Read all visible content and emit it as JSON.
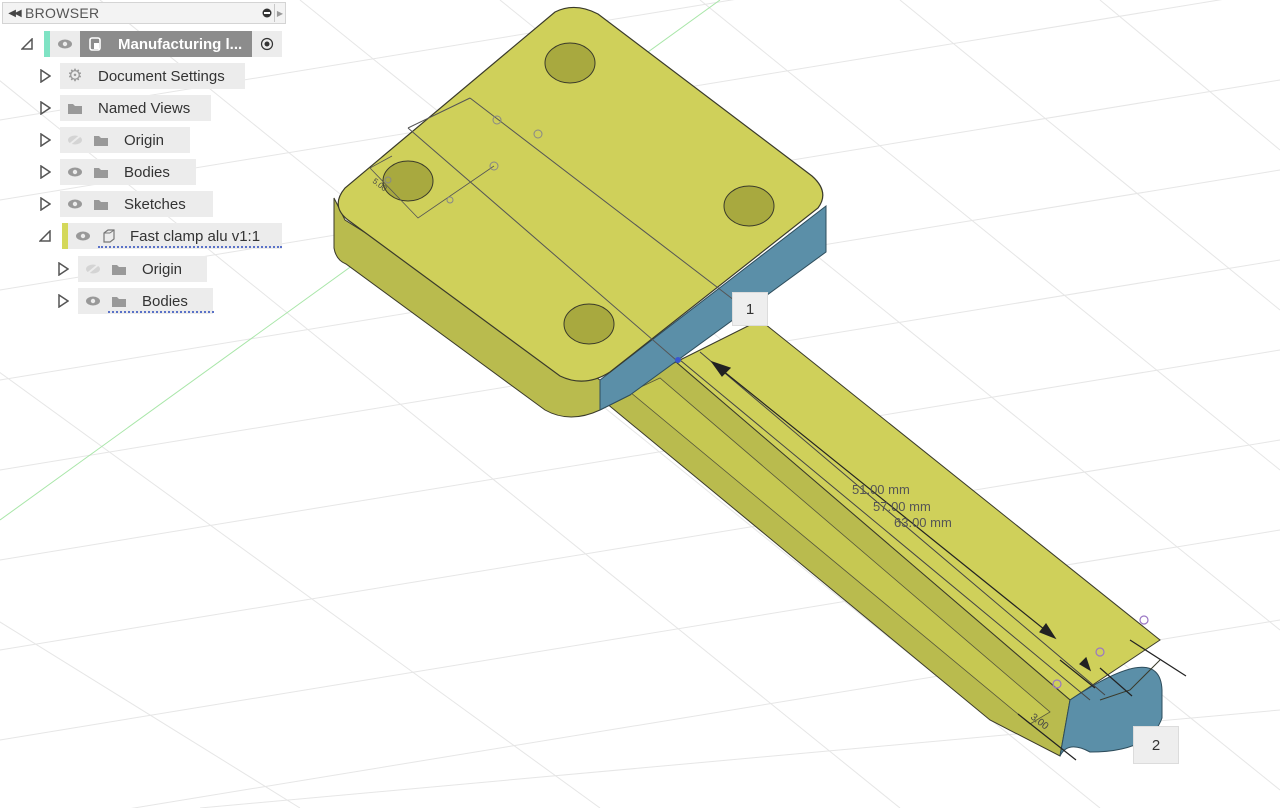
{
  "browser": {
    "title": "BROWSER",
    "collapse_icon": "double-left-arrow-icon",
    "pin_icon": "pin-icon",
    "root": {
      "label": "Manufacturing l...",
      "accent_color": "#7fe3c4"
    },
    "items": [
      {
        "label": "Document Settings",
        "icon": "gear-icon",
        "visibility": "none"
      },
      {
        "label": "Named Views",
        "icon": "folder-icon",
        "visibility": "none"
      },
      {
        "label": "Origin",
        "icon": "folder-icon",
        "visibility": "hidden"
      },
      {
        "label": "Bodies",
        "icon": "folder-icon",
        "visibility": "visible"
      },
      {
        "label": "Sketches",
        "icon": "folder-icon",
        "visibility": "visible"
      },
      {
        "label": "Fast clamp alu v1:1",
        "icon": "component-icon",
        "visibility": "visible",
        "accent_color": "#d4d85a"
      },
      {
        "label": "Origin",
        "icon": "folder-icon",
        "visibility": "hidden"
      },
      {
        "label": "Bodies",
        "icon": "folder-icon",
        "visibility": "visible"
      }
    ]
  },
  "canvas": {
    "face_color": "#cfd05a",
    "side_color": "#b9bb4e",
    "selected_face_color": "#5b8fa8",
    "dimensions": {
      "d1": "51.00 mm",
      "d2": "57.00 mm",
      "d3": "63.00 mm",
      "small_top": "5.00",
      "small_end": "3.00"
    },
    "callouts": {
      "c1": "1",
      "c2": "2"
    }
  }
}
